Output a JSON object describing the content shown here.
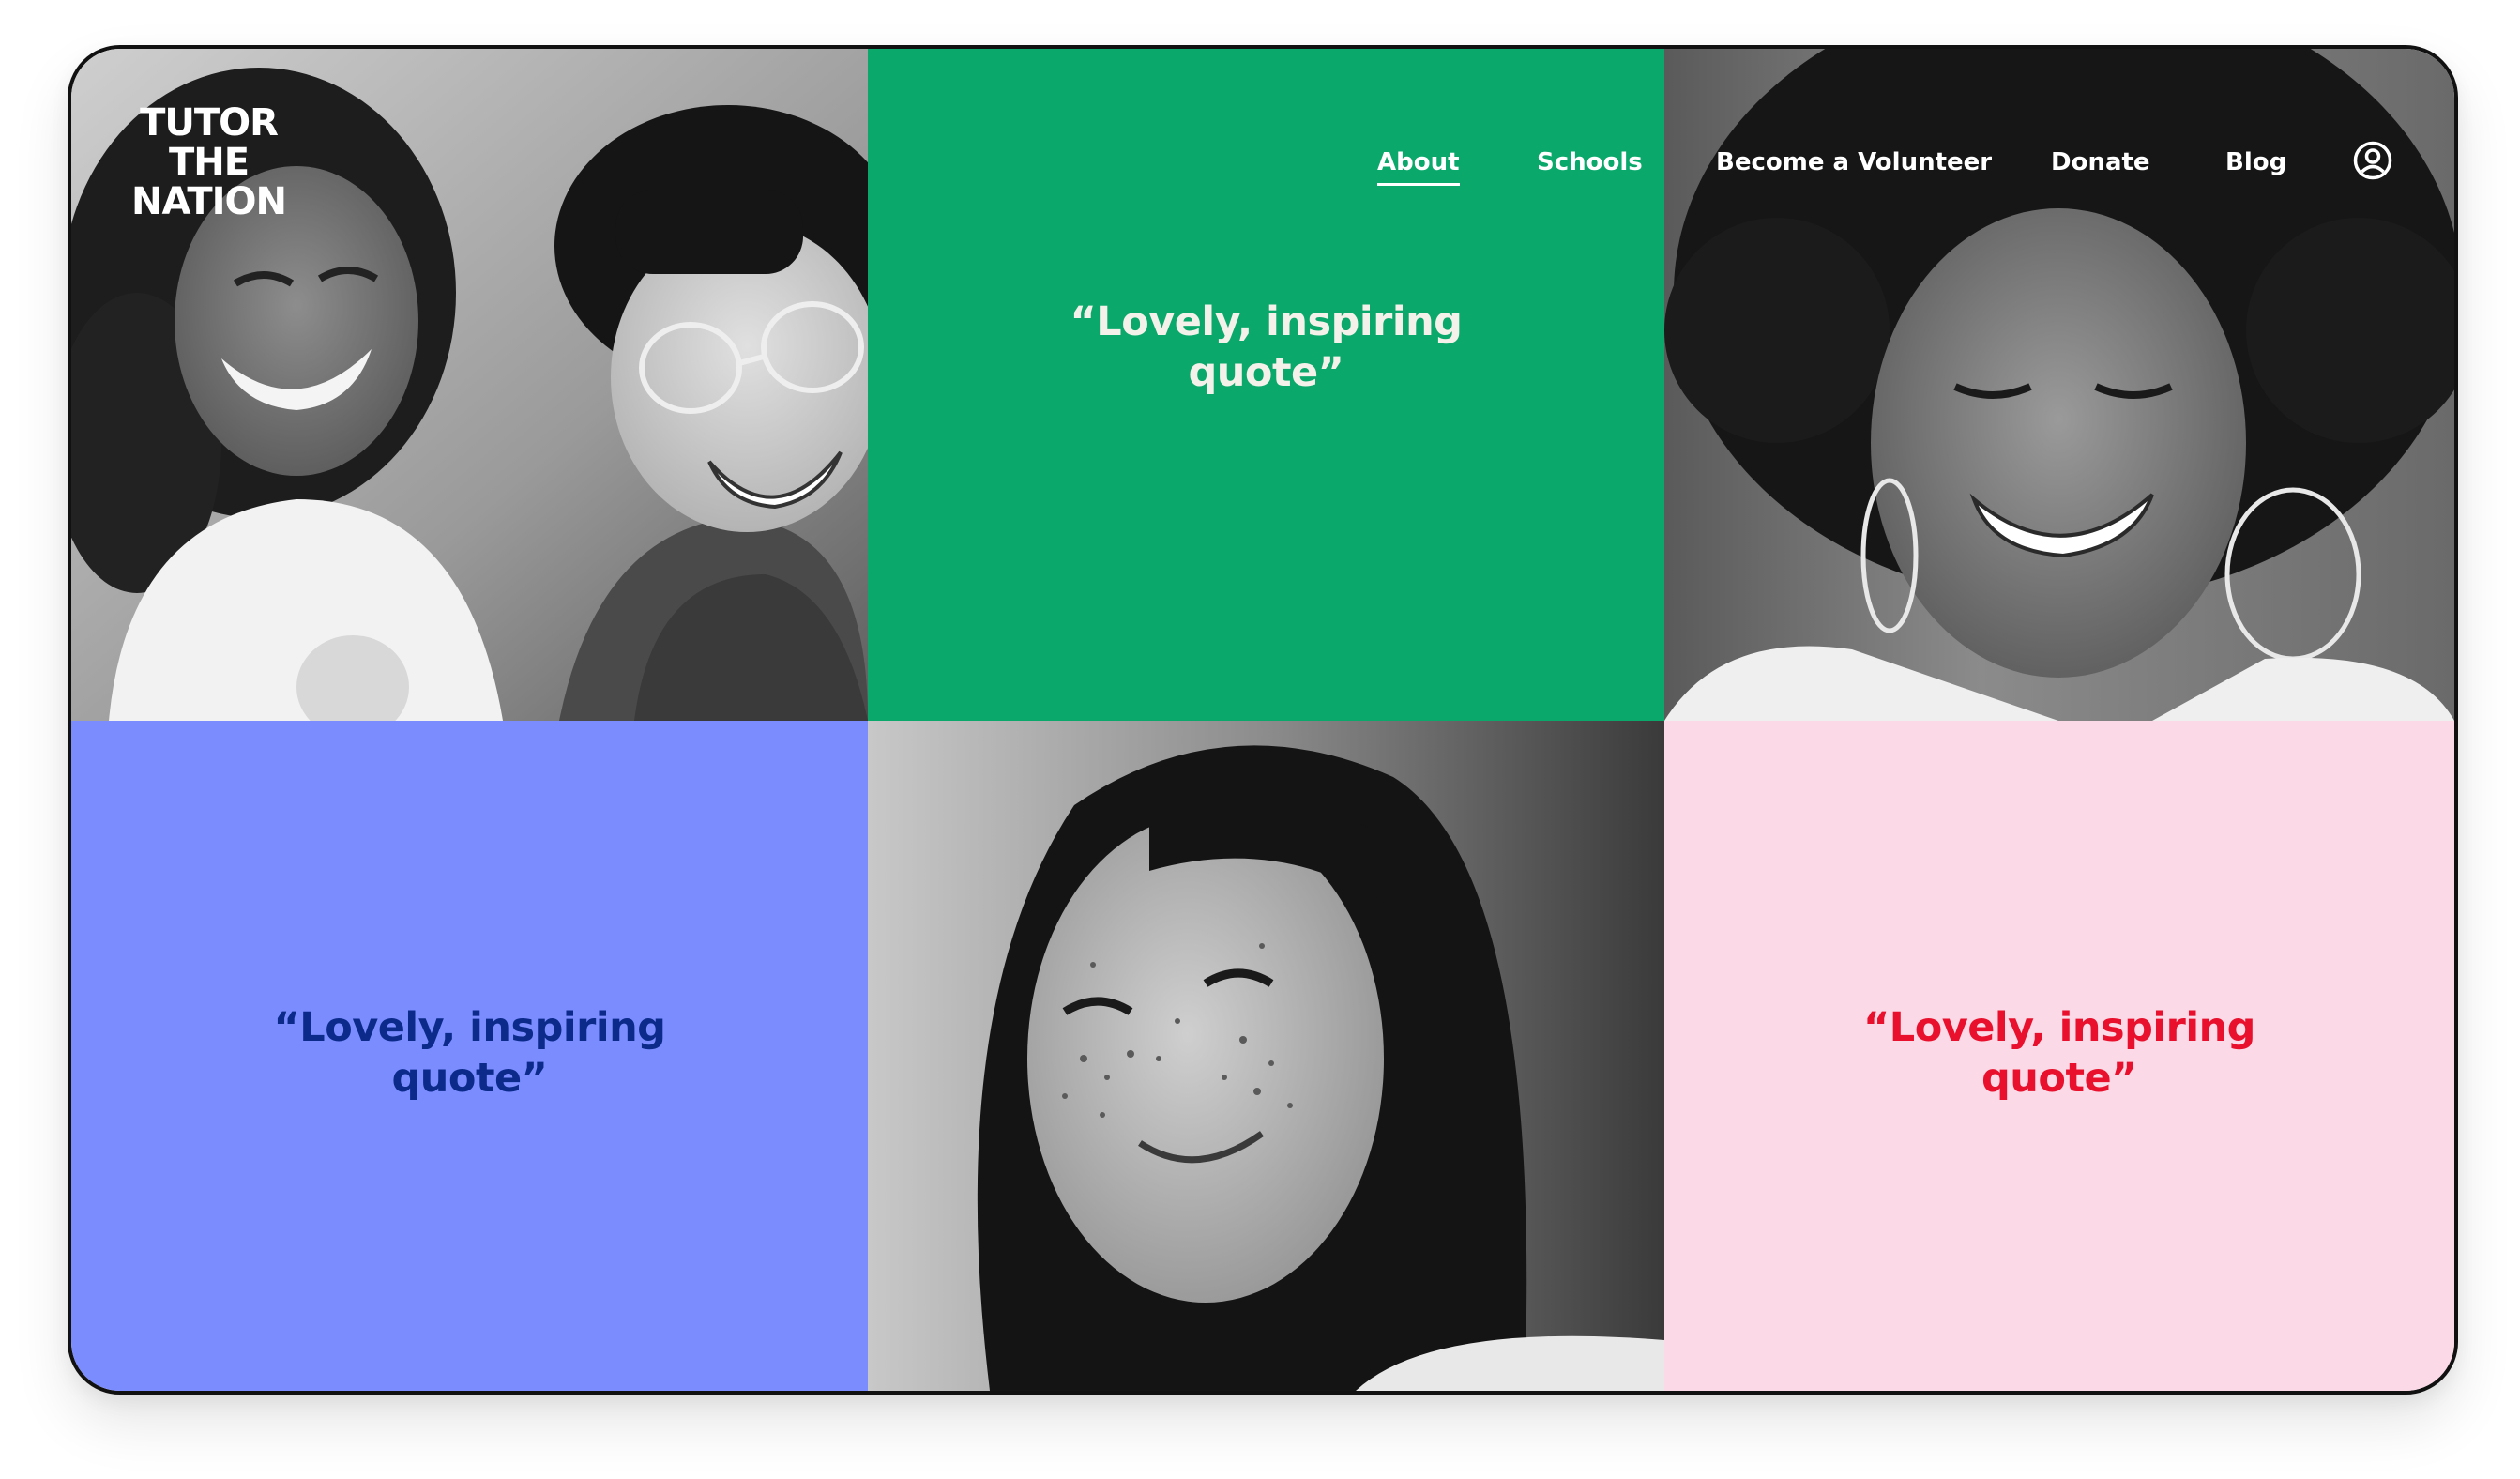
{
  "brand": {
    "logo_line1": "TUTOR",
    "logo_line2": "THE",
    "logo_line3": "NATION"
  },
  "nav": {
    "items": [
      {
        "label": "About",
        "active": true
      },
      {
        "label": "Schools",
        "active": false
      },
      {
        "label": "Become a Volunteer",
        "active": false
      },
      {
        "label": "Donate",
        "active": false
      },
      {
        "label": "Blog",
        "active": false
      }
    ],
    "account_icon": "user-circle-icon"
  },
  "tiles": {
    "quote_green": {
      "text": "“Lovely, inspiring quote”",
      "bg": "#0aa86b",
      "color": "#f4f1ea"
    },
    "quote_blue": {
      "text": "“Lovely, inspiring quote”",
      "bg": "#7b8cff",
      "color": "#0b2a8a"
    },
    "quote_pink": {
      "text": "“Lovely, inspiring quote”",
      "bg": "#fbd9e6",
      "color": "#e8102c"
    }
  }
}
